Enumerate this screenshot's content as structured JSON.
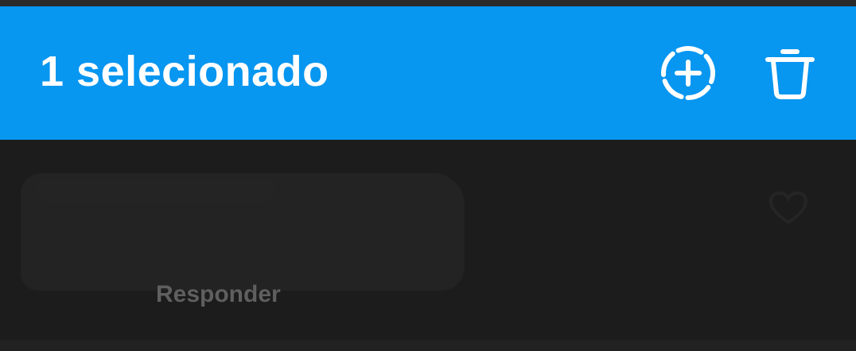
{
  "header": {
    "selection_title": "1 selecionado",
    "accent_color": "#0796f0",
    "actions": [
      {
        "icon": "dashed-circle-plus-icon"
      },
      {
        "icon": "trash-icon"
      }
    ]
  },
  "comment": {
    "reply_label": "Responder",
    "like_icon": "heart-icon"
  }
}
